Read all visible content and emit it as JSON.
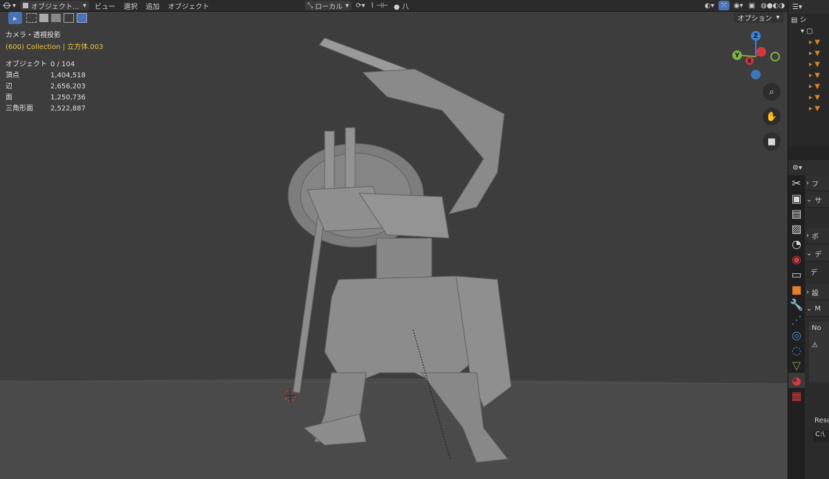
{
  "header": {
    "editor_icon": "viewport-icon",
    "mode_label": "オブジェクト...",
    "menu": [
      "ビュー",
      "選択",
      "追加",
      "オブジェクト"
    ],
    "orientation_label": "ローカル",
    "options_label": "オプション"
  },
  "overlay": {
    "camera_label": "カメラ・透視投影",
    "collection_label": "(600) Collection | 立方体.003"
  },
  "stats": [
    {
      "label": "オブジェクト",
      "value": "0 / 104"
    },
    {
      "label": "頂点",
      "value": "1,404,518"
    },
    {
      "label": "辺",
      "value": "2,656,203"
    },
    {
      "label": "面",
      "value": "1,250,736"
    },
    {
      "label": "三角形面",
      "value": "2,522,887"
    }
  ],
  "gizmo": {
    "z": "Z",
    "y": "Y",
    "x": "X"
  },
  "navtools": [
    "zoom-icon",
    "hand-icon",
    "camera-icon"
  ],
  "right_panel": {
    "outliner_label": "シ",
    "sections": [
      {
        "label": "フ"
      },
      {
        "label": "サ"
      },
      {
        "label": "ボ"
      },
      {
        "label": "デ"
      },
      {
        "label": "デ"
      },
      {
        "label": "設"
      },
      {
        "label": "M"
      },
      {
        "label": "No"
      },
      {
        "label": "Reso"
      },
      {
        "label": "C:\\"
      }
    ]
  },
  "colors": {
    "collection_text": "#e8c93a",
    "accent": "#4772b3",
    "axis_x": "#d2393f",
    "axis_y": "#7cb342",
    "axis_z": "#3d83d9"
  }
}
